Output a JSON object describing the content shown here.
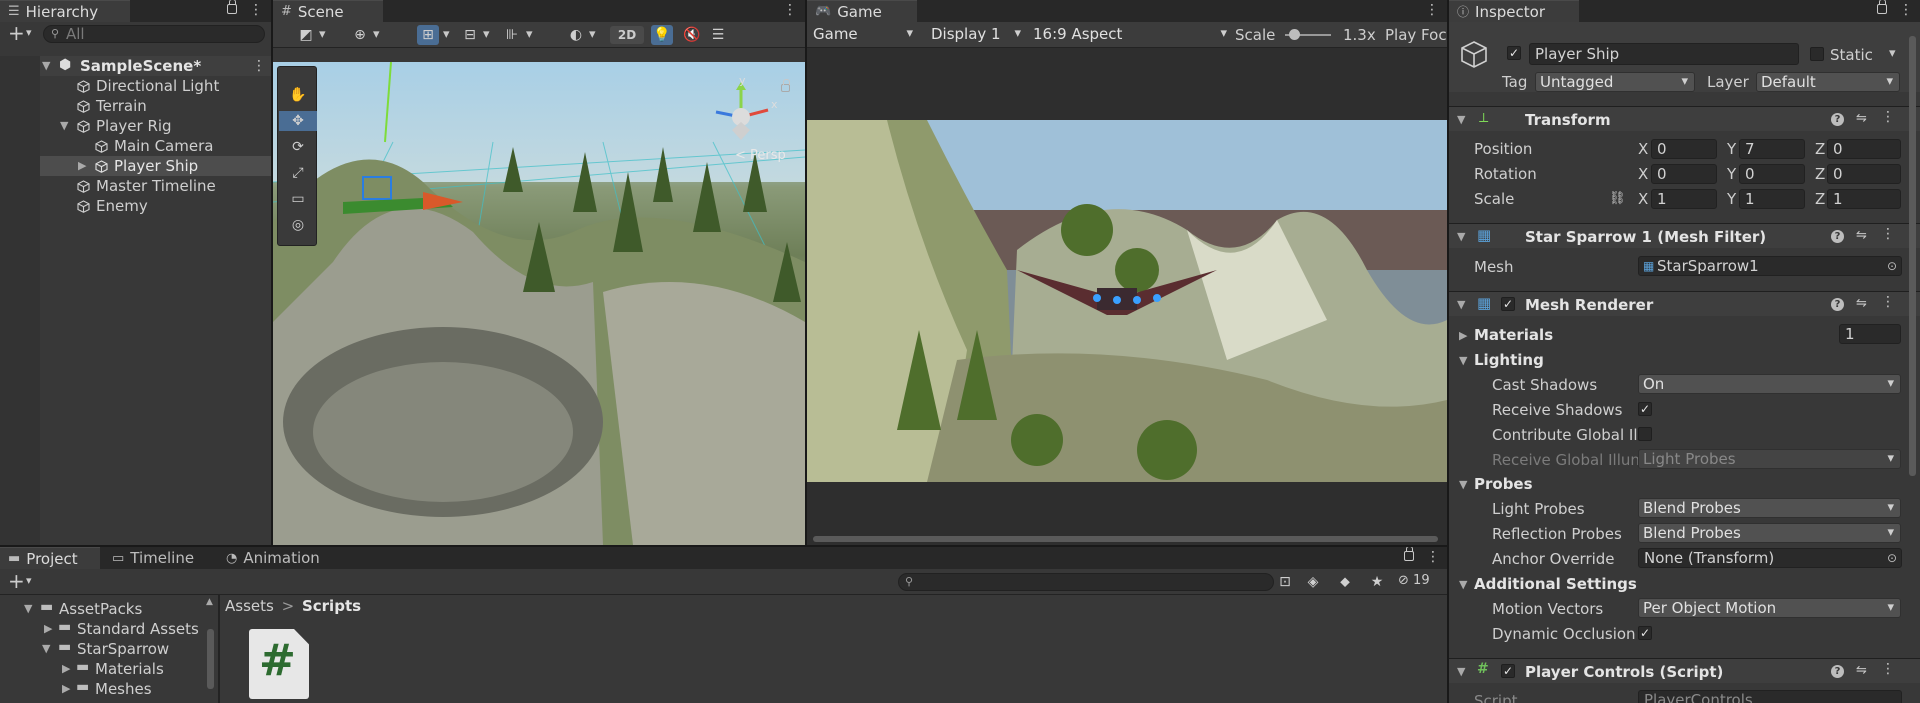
{
  "hierarchy": {
    "tab_label": "Hierarchy",
    "search_placeholder": "All",
    "scene_name": "SampleScene*",
    "items": [
      {
        "label": "Directional Light"
      },
      {
        "label": "Terrain"
      },
      {
        "label": "Player Rig"
      },
      {
        "label": "Main Camera"
      },
      {
        "label": "Player Ship"
      },
      {
        "label": "Master Timeline"
      },
      {
        "label": "Enemy"
      }
    ]
  },
  "scene": {
    "tab_label": "Scene",
    "mode_2d": "2D",
    "gizmo_labels": {
      "y": "y",
      "x": "x",
      "z": "z",
      "persp": "< Persp"
    }
  },
  "game": {
    "tab_label": "Game",
    "mode": "Game",
    "display": "Display 1",
    "aspect": "16:9 Aspect",
    "scale_label": "Scale",
    "scale_value": "1.3x",
    "play_focus": "Play Foc"
  },
  "inspector": {
    "tab_label": "Inspector",
    "object_name": "Player Ship",
    "static_label": "Static",
    "tag_label": "Tag",
    "tag_value": "Untagged",
    "layer_label": "Layer",
    "layer_value": "Default",
    "transform": {
      "title": "Transform",
      "position_label": "Position",
      "rotation_label": "Rotation",
      "scale_label": "Scale",
      "axis_x": "X",
      "axis_y": "Y",
      "axis_z": "Z",
      "position": {
        "x": "0",
        "y": "7",
        "z": "0"
      },
      "rotation": {
        "x": "0",
        "y": "0",
        "z": "0"
      },
      "scale": {
        "x": "1",
        "y": "1",
        "z": "1"
      }
    },
    "mesh_filter": {
      "title": "Star Sparrow 1 (Mesh Filter)",
      "mesh_label": "Mesh",
      "mesh_value": "StarSparrow1"
    },
    "mesh_renderer": {
      "title": "Mesh Renderer",
      "materials_label": "Materials",
      "materials_count": "1",
      "lighting_label": "Lighting",
      "cast_shadows_label": "Cast Shadows",
      "cast_shadows_value": "On",
      "receive_shadows_label": "Receive Shadows",
      "contribute_gi_label": "Contribute Global Ill",
      "receive_gi_label": "Receive Global Illun",
      "receive_gi_value": "Light Probes",
      "probes_label": "Probes",
      "light_probes_label": "Light Probes",
      "light_probes_value": "Blend Probes",
      "reflection_probes_label": "Reflection Probes",
      "reflection_probes_value": "Blend Probes",
      "anchor_override_label": "Anchor Override",
      "anchor_override_value": "None (Transform)",
      "additional_label": "Additional Settings",
      "motion_vectors_label": "Motion Vectors",
      "motion_vectors_value": "Per Object Motion",
      "dynamic_occlusion_label": "Dynamic Occlusion"
    },
    "player_controls": {
      "title": "Player Controls (Script)",
      "script_label": "Script",
      "script_value": "PlayerControls"
    }
  },
  "bottom": {
    "tabs": [
      {
        "label": "Project"
      },
      {
        "label": "Timeline"
      },
      {
        "label": "Animation"
      }
    ],
    "hidden_count": "19",
    "breadcrumb_root": "Assets",
    "breadcrumb_sep": ">",
    "breadcrumb_current": "Scripts",
    "tree": [
      {
        "label": "AssetPacks"
      },
      {
        "label": "Standard Assets"
      },
      {
        "label": "StarSparrow"
      },
      {
        "label": "Materials"
      },
      {
        "label": "Meshes"
      }
    ],
    "script_glyph": "#"
  },
  "colors": {
    "panel_bg": "#383838",
    "tab_bar": "#282828",
    "selection": "#4d4d4d",
    "accent_blue": "#3a79bb"
  }
}
